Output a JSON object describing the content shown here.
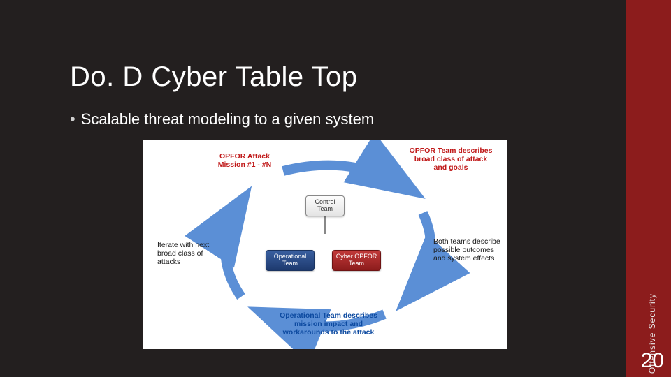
{
  "slide": {
    "title": "Do. D Cyber Table Top",
    "bullet_marker": "•",
    "bullet_text": "Scalable threat modeling to a given system",
    "side_label": "Offensive Security",
    "page_number": "20"
  },
  "diagram": {
    "labels": {
      "opfor_mission": "OPFOR Attack Mission #1 - #N",
      "opfor_team_desc": "OPFOR Team describes broad class of attack and goals",
      "iterate": "Iterate with next broad class of attacks",
      "both_teams": "Both teams describe possible outcomes and system effects",
      "operational_desc": "Operational Team describes mission impact and workarounds to the attack"
    },
    "boxes": {
      "control": "Control Team",
      "operational": "Operational Team",
      "cyber_opfor": "Cyber OPFOR Team"
    }
  }
}
